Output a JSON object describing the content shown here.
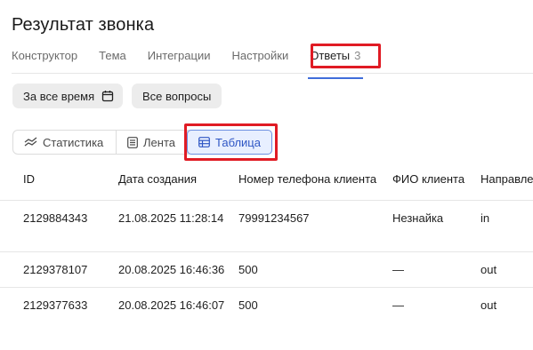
{
  "page": {
    "title": "Результат звонка"
  },
  "tabs": [
    {
      "label": "Конструктор"
    },
    {
      "label": "Тема"
    },
    {
      "label": "Интеграции"
    },
    {
      "label": "Настройки"
    },
    {
      "label": "Ответы",
      "count": "3",
      "active": true
    }
  ],
  "filters": {
    "period": "За все время",
    "questions": "Все вопросы"
  },
  "views": [
    {
      "label": "Статистика"
    },
    {
      "label": "Лента"
    },
    {
      "label": "Таблица",
      "active": true
    }
  ],
  "table": {
    "columns": [
      "ID",
      "Дата создания",
      "Номер телефона клиента",
      "ФИО клиента",
      "Направле"
    ],
    "rows": [
      {
        "id": "2129884343",
        "created": "21.08.2025 11:28:14",
        "phone": "79991234567",
        "name": "Незнайка",
        "direction": "in"
      },
      {
        "id": "2129378107",
        "created": "20.08.2025 16:46:36",
        "phone": "500",
        "name": "—",
        "direction": "out"
      },
      {
        "id": "2129377633",
        "created": "20.08.2025 16:46:07",
        "phone": "500",
        "name": "—",
        "direction": "out"
      }
    ]
  },
  "colors": {
    "accent": "#3f6dda",
    "highlight": "#e01b24",
    "active_view_bg": "#e8efff"
  },
  "icons": {
    "calendar": "calendar-icon",
    "statistics": "chart-line-icon",
    "feed": "list-icon",
    "table": "table-icon"
  }
}
